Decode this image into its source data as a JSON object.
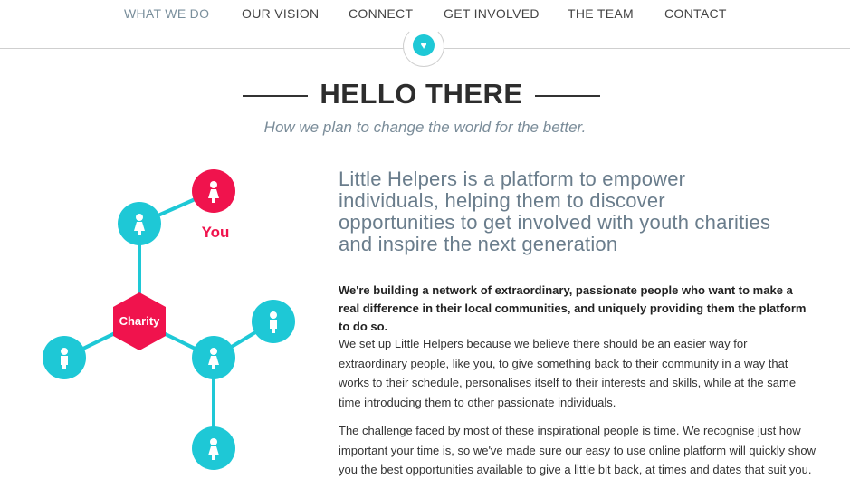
{
  "nav": {
    "items": [
      {
        "label": "WHAT WE DO",
        "active": true
      },
      {
        "label": "OUR VISION",
        "active": false
      },
      {
        "label": "CONNECT",
        "active": false
      },
      {
        "label": "GET INVOLVED",
        "active": false
      },
      {
        "label": "THE TEAM",
        "active": false
      },
      {
        "label": "CONTACT",
        "active": false
      }
    ]
  },
  "badge": {
    "icon": "heart-icon",
    "glyph": "♥"
  },
  "hero": {
    "title": "HELLO THERE",
    "tagline": "How we plan to change the world for the better."
  },
  "diagram": {
    "you_label": "You",
    "charity_label": "Charity",
    "colors": {
      "teal": "#1ec8d6",
      "red": "#f0134d"
    }
  },
  "content": {
    "lead": "Little Helpers is a platform to empower individuals, helping them to discover opportunities to get involved with youth charities and inspire the next generation",
    "bold": "We're building a network of extraordinary, passionate people who want to make a real difference in their local communities, and uniquely providing them the platform to do so.",
    "paragraph1": "We set up Little Helpers because we believe there should be an easier way for extraordinary people, like you, to give something back to their community in a way that works to their schedule, personalises itself to their interests and skills, while at the same time introducing them to other passionate individuals.",
    "paragraph2": "The challenge faced by most of these inspirational people is time. We recognise just how important your time is, so we've made sure our easy to use online platform will quickly show you the best opportunities available to give a little bit back, at times and dates that suit you."
  }
}
